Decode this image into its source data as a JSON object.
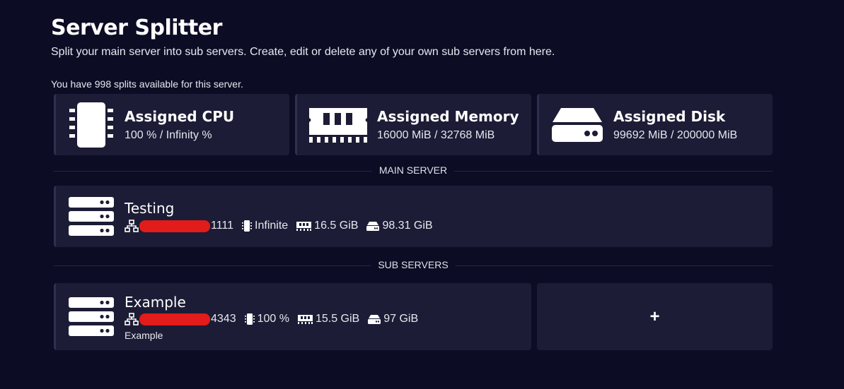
{
  "header": {
    "title": "Server Splitter",
    "subtitle": "Split your main server into sub servers. Create, edit or delete any of your own sub servers from here.",
    "splits_note": "You have 998 splits available for this server."
  },
  "resources": {
    "cpu": {
      "title": "Assigned CPU",
      "value": "100 % / Infinity %",
      "icon": "cpu-chip-icon"
    },
    "memory": {
      "title": "Assigned Memory",
      "value": "16000 MiB / 32768 MiB",
      "icon": "memory-stick-icon"
    },
    "disk": {
      "title": "Assigned Disk",
      "value": "99692 MiB / 200000 MiB",
      "icon": "hard-drive-icon"
    }
  },
  "sections": {
    "main_server": "MAIN SERVER",
    "sub_servers": "SUB SERVERS"
  },
  "main_server": {
    "name": "Testing",
    "port_suffix": "1111",
    "cpu": "Infinite",
    "memory": "16.5 GiB",
    "disk": "98.31 GiB"
  },
  "sub_servers": [
    {
      "name": "Example",
      "port_suffix": "4343",
      "cpu": "100 %",
      "memory": "15.5 GiB",
      "disk": "97 GiB",
      "description": "Example"
    }
  ],
  "add_button": {
    "label": "+"
  },
  "colors": {
    "background": "#0c0c24",
    "card": "#1c1c36",
    "redaction": "#e21b1b"
  }
}
